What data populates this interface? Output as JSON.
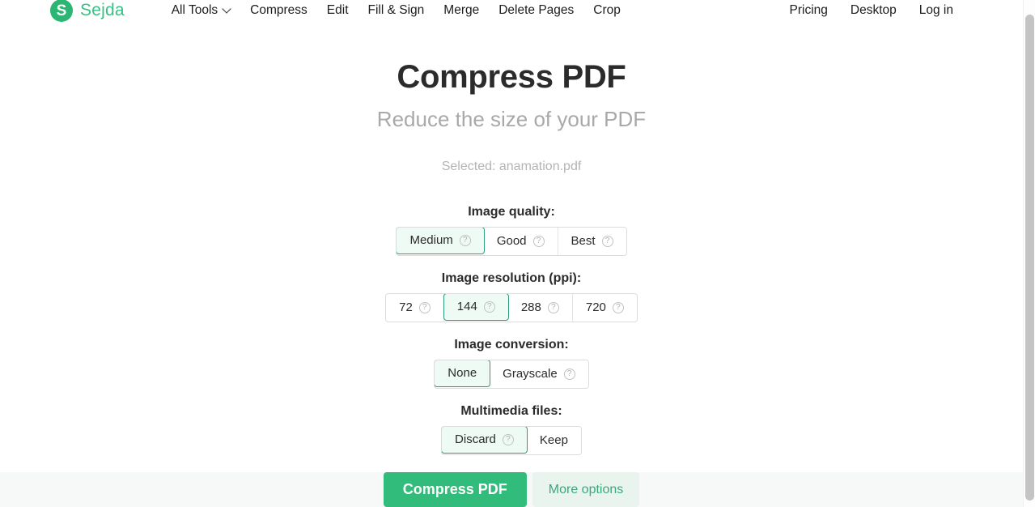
{
  "nav": {
    "brand": {
      "mark": "S",
      "name": "Sejda"
    },
    "left_items": [
      {
        "label": "All Tools",
        "icon": "chevron-down-icon",
        "has_chevron": true
      },
      {
        "label": "Compress",
        "has_chevron": false
      },
      {
        "label": "Edit",
        "has_chevron": false
      },
      {
        "label": "Fill & Sign",
        "has_chevron": false
      },
      {
        "label": "Merge",
        "has_chevron": false
      },
      {
        "label": "Delete Pages",
        "has_chevron": false
      },
      {
        "label": "Crop",
        "has_chevron": false
      }
    ],
    "right_items": [
      {
        "label": "Pricing"
      },
      {
        "label": "Desktop"
      },
      {
        "label": "Log in"
      }
    ]
  },
  "main": {
    "title": "Compress PDF",
    "subtitle": "Reduce the size of your PDF",
    "selected_file": "Selected: anamation.pdf"
  },
  "options": {
    "quality": {
      "label": "Image quality:",
      "choices": [
        {
          "label": "Medium",
          "selected": true,
          "help": "?"
        },
        {
          "label": "Good",
          "selected": false,
          "help": "?"
        },
        {
          "label": "Best",
          "selected": false,
          "help": "?"
        }
      ]
    },
    "resolution": {
      "label": "Image resolution (ppi):",
      "choices": [
        {
          "label": "72",
          "selected": false,
          "help": "?"
        },
        {
          "label": "144",
          "selected": true,
          "help": "?"
        },
        {
          "label": "288",
          "selected": false,
          "help": "?"
        },
        {
          "label": "720",
          "selected": false,
          "help": "?"
        }
      ]
    },
    "conversion": {
      "label": "Image conversion:",
      "choices": [
        {
          "label": "None",
          "selected": true,
          "help": null
        },
        {
          "label": "Grayscale",
          "selected": false,
          "help": "?"
        }
      ]
    },
    "multimedia": {
      "label": "Multimedia files:",
      "choices": [
        {
          "label": "Discard",
          "selected": true,
          "help": "?"
        },
        {
          "label": "Keep",
          "selected": false,
          "help": null
        }
      ]
    }
  },
  "actions": {
    "primary_label": "Compress PDF",
    "secondary_label": "More options"
  },
  "colors": {
    "brand_green": "#35c183",
    "primary_button": "#31bc7c",
    "selected_border": "#2e9e7a",
    "selected_bg": "#eefbf4",
    "secondary_bg": "#e9f4ef",
    "secondary_text": "#3aa87c"
  }
}
